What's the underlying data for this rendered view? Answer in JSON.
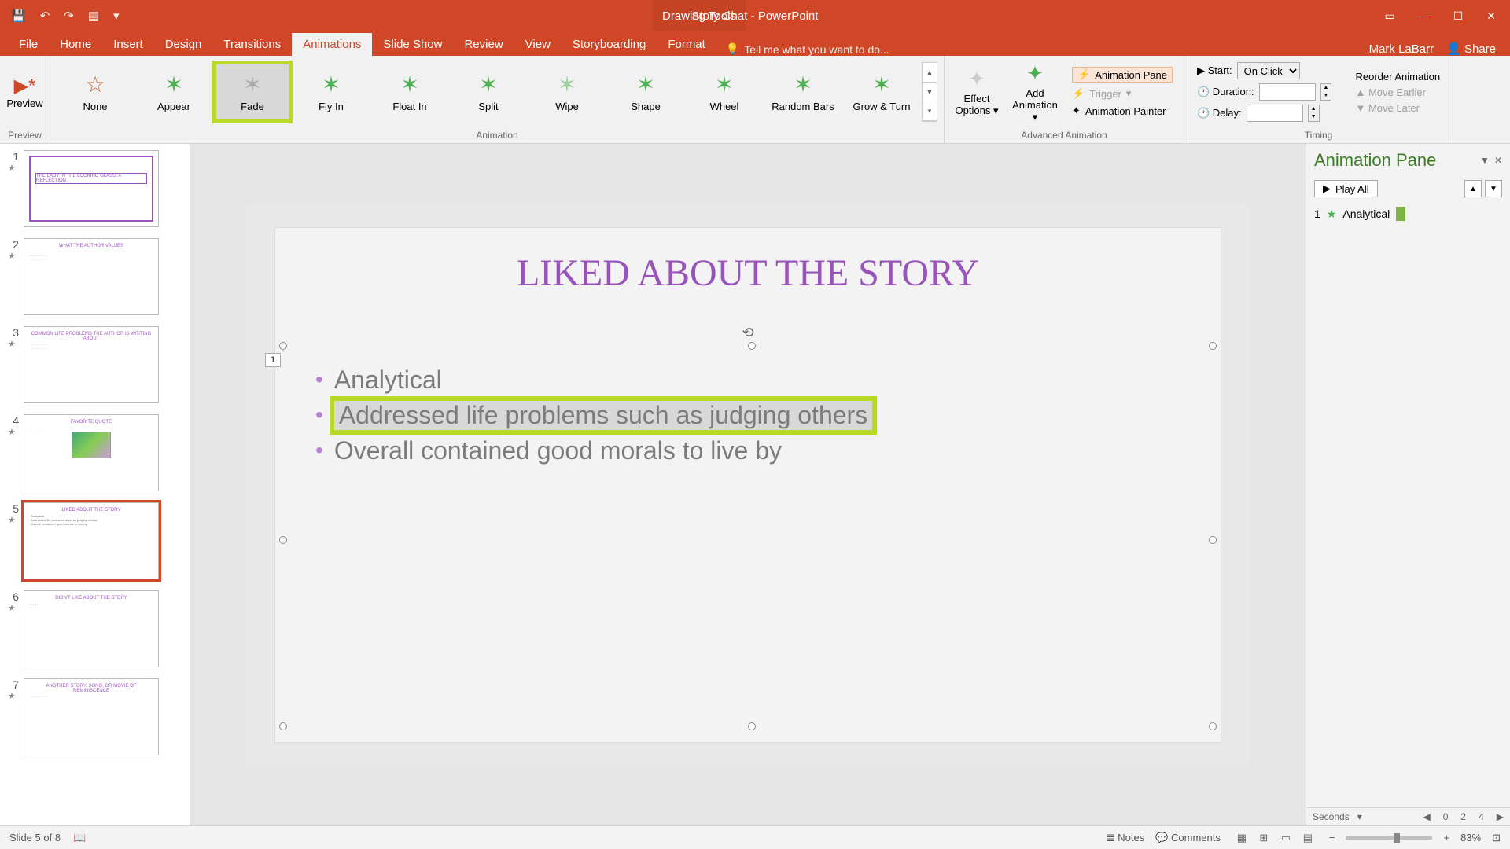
{
  "titlebar": {
    "title": "Story Chat - PowerPoint",
    "context_tools": "Drawing Tools",
    "qat": {
      "save": "💾",
      "undo": "↶",
      "redo": "↷",
      "startshow": "▤",
      "more": "▾"
    },
    "win": {
      "displayopts": "▭",
      "min": "—",
      "max": "☐",
      "close": "✕"
    }
  },
  "tabs": {
    "file": "File",
    "home": "Home",
    "insert": "Insert",
    "design": "Design",
    "transitions": "Transitions",
    "animations": "Animations",
    "slideshow": "Slide Show",
    "review": "Review",
    "view": "View",
    "storyboarding": "Storyboarding",
    "format": "Format",
    "tellme": "Tell me what you want to do..."
  },
  "user": {
    "name": "Mark LaBarr",
    "share": "Share"
  },
  "ribbon": {
    "preview": {
      "label": "Preview",
      "group": "Preview"
    },
    "animations_group": "Animation",
    "gallery": [
      {
        "label": "None"
      },
      {
        "label": "Appear"
      },
      {
        "label": "Fade"
      },
      {
        "label": "Fly In"
      },
      {
        "label": "Float In"
      },
      {
        "label": "Split"
      },
      {
        "label": "Wipe"
      },
      {
        "label": "Shape"
      },
      {
        "label": "Wheel"
      },
      {
        "label": "Random Bars"
      },
      {
        "label": "Grow & Turn"
      }
    ],
    "effect_options": "Effect Options",
    "add_animation": "Add Animation",
    "adv_group": "Advanced Animation",
    "anim_pane": "Animation Pane",
    "trigger": "Trigger",
    "anim_painter": "Animation Painter",
    "timing_group": "Timing",
    "start_label": "Start:",
    "start_value": "On Click",
    "duration_label": "Duration:",
    "duration_value": "",
    "delay_label": "Delay:",
    "delay_value": "",
    "reorder": "Reorder Animation",
    "move_earlier": "Move Earlier",
    "move_later": "Move Later"
  },
  "slide": {
    "title": "LIKED ABOUT THE STORY",
    "bullets": [
      "Analytical",
      "Addressed life problems such as judging others",
      "Overall contained good morals to live by"
    ],
    "anim_tag": "1"
  },
  "thumbs": [
    {
      "title": "THE LADY IN THE LOOKING GLASS: A REFLECTION"
    },
    {
      "title": "WHAT THE AUTHOR VALUES"
    },
    {
      "title": "COMMON LIFE PROBLEMS THE AUTHOR IS WRITING ABOUT"
    },
    {
      "title": "FAVORITE QUOTE"
    },
    {
      "title": "LIKED ABOUT THE STORY"
    },
    {
      "title": "DIDN'T LIKE ABOUT THE STORY"
    },
    {
      "title": "ANOTHER STORY, SONG, OR MOVIE OF REMINISCENCE"
    }
  ],
  "anim_pane": {
    "title": "Animation Pane",
    "play_all": "Play All",
    "items": [
      {
        "num": "1",
        "label": "Analytical"
      }
    ],
    "timeline": {
      "label": "Seconds",
      "marks": [
        "0",
        "2",
        "4"
      ]
    }
  },
  "status": {
    "slide_info": "Slide 5 of 8",
    "notes": "Notes",
    "comments": "Comments",
    "zoom": "83%"
  }
}
